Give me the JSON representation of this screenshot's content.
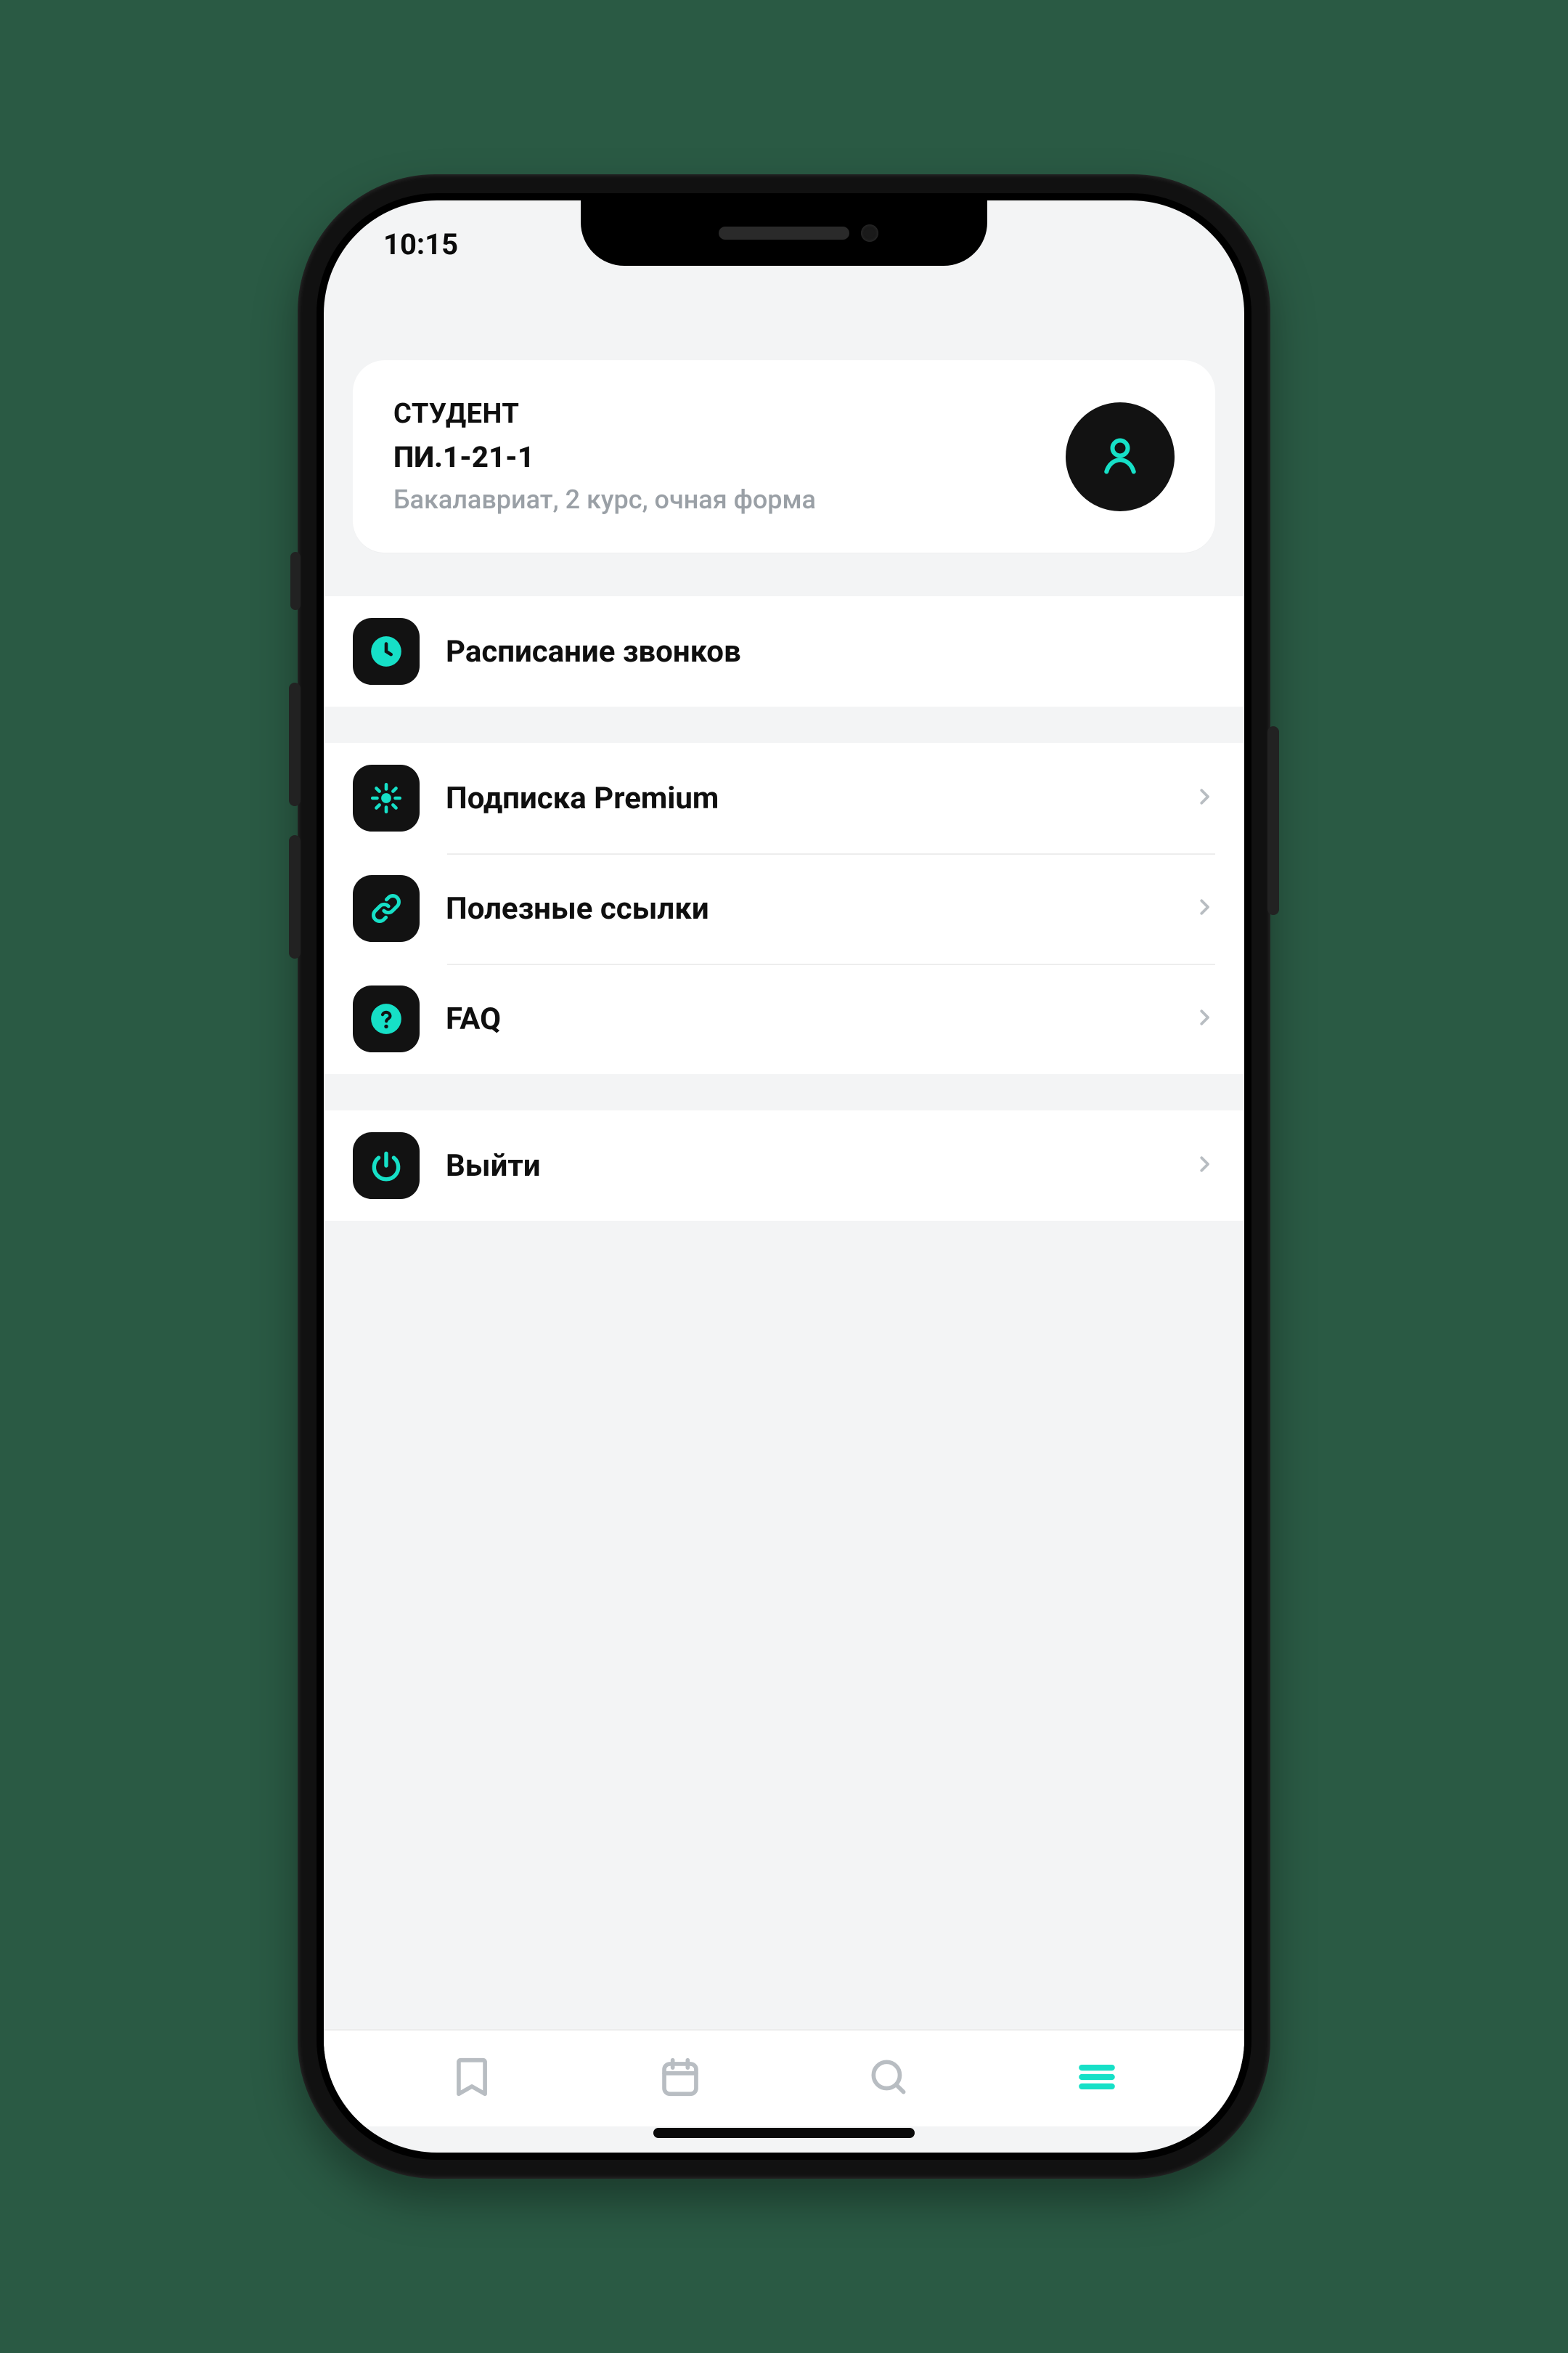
{
  "statusbar": {
    "time": "10:15"
  },
  "profile": {
    "role": "СТУДЕНТ",
    "group": "ПИ.1-21-1",
    "description": "Бакалавриат, 2 курс, очная форма"
  },
  "sections": [
    {
      "rows": [
        {
          "icon": "clock",
          "label": "Расписание звонков",
          "chevron": false
        }
      ]
    },
    {
      "rows": [
        {
          "icon": "premium",
          "label": "Подписка Premium",
          "chevron": true
        },
        {
          "icon": "link",
          "label": "Полезные ссылки",
          "chevron": true
        },
        {
          "icon": "help",
          "label": "FAQ",
          "chevron": true
        }
      ]
    },
    {
      "rows": [
        {
          "icon": "power",
          "label": "Выйти",
          "chevron": true
        }
      ]
    }
  ],
  "tabs": {
    "items": [
      "bookmark",
      "calendar",
      "search",
      "menu"
    ],
    "active_index": 3
  },
  "colors": {
    "accent": "#16e0c7",
    "muted": "#b8bdc2",
    "dark": "#121212"
  }
}
